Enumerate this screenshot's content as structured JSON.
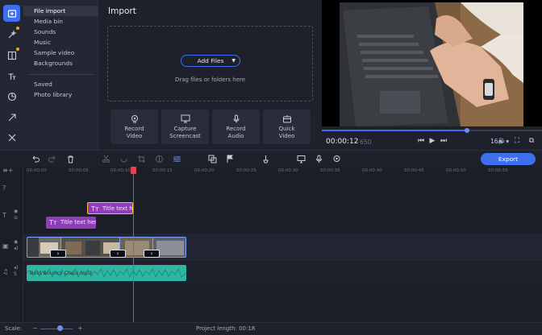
{
  "rail": {
    "items": [
      {
        "icon": "import-icon",
        "active": true
      },
      {
        "icon": "magic-wand-icon",
        "dot": true
      },
      {
        "icon": "transitions-icon",
        "dot": true
      },
      {
        "icon": "titles-icon"
      },
      {
        "icon": "stickers-icon"
      },
      {
        "icon": "arrow-icon"
      },
      {
        "icon": "tools-icon"
      }
    ]
  },
  "menu": {
    "items": [
      "File import",
      "Media bin",
      "Sounds",
      "Music",
      "Sample video",
      "Backgrounds"
    ],
    "items2": [
      "Saved",
      "Photo library"
    ]
  },
  "import": {
    "title": "Import",
    "add_files": "Add Files",
    "drag_hint": "Drag files or folders here",
    "buttons": [
      {
        "label1": "Record",
        "label2": "Video",
        "icon": "camera-icon"
      },
      {
        "label1": "Capture",
        "label2": "Screencast",
        "icon": "monitor-icon"
      },
      {
        "label1": "Record",
        "label2": "Audio",
        "icon": "microphone-icon"
      },
      {
        "label1": "Quick",
        "label2": "Video",
        "icon": "magic-box-icon"
      }
    ]
  },
  "player": {
    "time_current": "00:00:12",
    "time_total": "650",
    "progress": 0.66,
    "ratio": "16:9"
  },
  "toolbar": {
    "export_label": "Export"
  },
  "timeline": {
    "ruler": [
      "00:00:00",
      "00:00:05",
      "00:00:10",
      "00:00:15",
      "00:00:20",
      "00:00:25",
      "00:00:30",
      "00:00:35",
      "00:00:40",
      "00:00:45",
      "00:00:50",
      "00:00:55"
    ],
    "title_clips": [
      "Title text he",
      "Title text her"
    ],
    "audio_name": "Bold Bouncy Claps.mp3"
  },
  "status": {
    "scale_label": "Scale:",
    "scale_value": 0.55,
    "project_length": "Project length:  00:18"
  },
  "colors": {
    "accent": "#3d6ff0",
    "title_clip": "#8e3fb8",
    "audio_clip": "#2fb6a3",
    "playhead": "#e6404a"
  }
}
